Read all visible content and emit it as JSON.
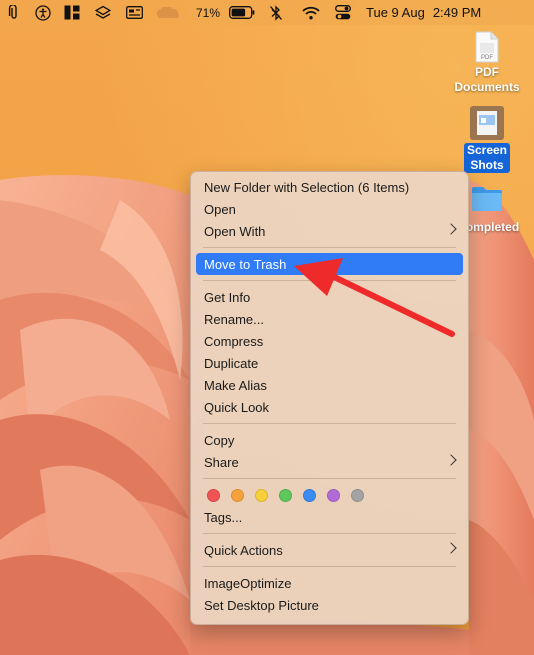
{
  "menubar": {
    "battery": "71%",
    "date": "Tue 9 Aug",
    "time": "2:49 PM"
  },
  "desktop": {
    "icons": [
      {
        "label_line1": "PDF",
        "label_line2": "Documents",
        "icon": "pdf-file-icon"
      },
      {
        "label_line1": "Screen",
        "label_line2": "Shots",
        "icon": "image-file-icon",
        "selected": true
      },
      {
        "label_line1": "ompleted",
        "icon": "folder-icon"
      }
    ]
  },
  "context_menu": {
    "new_folder": "New Folder with Selection (6 Items)",
    "open": "Open",
    "open_with": "Open With",
    "move_to_trash": "Move to Trash",
    "get_info": "Get Info",
    "rename": "Rename...",
    "compress": "Compress",
    "duplicate": "Duplicate",
    "make_alias": "Make Alias",
    "quick_look": "Quick Look",
    "copy": "Copy",
    "share": "Share",
    "tags": "Tags...",
    "quick_actions": "Quick Actions",
    "image_optimize": "ImageOptimize",
    "set_desktop_picture": "Set Desktop Picture",
    "tag_colors": [
      "#f05454",
      "#f6a23c",
      "#f6cf3a",
      "#5cc75a",
      "#3a8bf2",
      "#b26ad6",
      "#a3a3a3"
    ],
    "highlight_color": "#2f7cf6"
  },
  "annotation": {
    "arrow_color": "#ee2a2a"
  }
}
